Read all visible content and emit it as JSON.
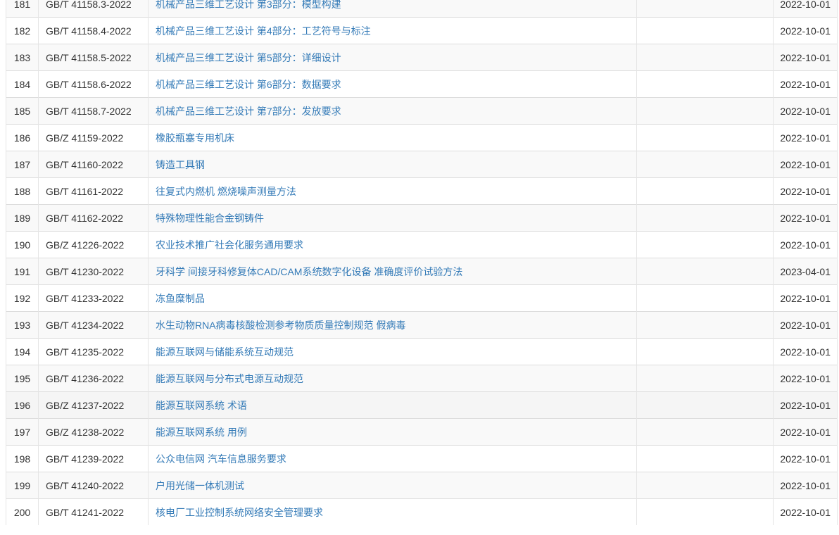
{
  "table": {
    "rows": [
      {
        "no": "181",
        "code": "GB/T 41158.3-2022",
        "title": "机械产品三维工艺设计 第3部分：模型构建",
        "date": "2022-10-01"
      },
      {
        "no": "182",
        "code": "GB/T 41158.4-2022",
        "title": "机械产品三维工艺设计 第4部分：工艺符号与标注",
        "date": "2022-10-01"
      },
      {
        "no": "183",
        "code": "GB/T 41158.5-2022",
        "title": "机械产品三维工艺设计 第5部分：详细设计",
        "date": "2022-10-01"
      },
      {
        "no": "184",
        "code": "GB/T 41158.6-2022",
        "title": "机械产品三维工艺设计 第6部分：数据要求",
        "date": "2022-10-01"
      },
      {
        "no": "185",
        "code": "GB/T 41158.7-2022",
        "title": "机械产品三维工艺设计 第7部分：发放要求",
        "date": "2022-10-01"
      },
      {
        "no": "186",
        "code": "GB/Z 41159-2022",
        "title": "橡胶瓶塞专用机床",
        "date": "2022-10-01"
      },
      {
        "no": "187",
        "code": "GB/T 41160-2022",
        "title": "铸造工具钢",
        "date": "2022-10-01"
      },
      {
        "no": "188",
        "code": "GB/T 41161-2022",
        "title": "往复式内燃机 燃烧噪声测量方法",
        "date": "2022-10-01"
      },
      {
        "no": "189",
        "code": "GB/T 41162-2022",
        "title": "特殊物理性能合金钢铸件",
        "date": "2022-10-01"
      },
      {
        "no": "190",
        "code": "GB/Z 41226-2022",
        "title": "农业技术推广社会化服务通用要求",
        "date": "2022-10-01"
      },
      {
        "no": "191",
        "code": "GB/T 41230-2022",
        "title": "牙科学 间接牙科修复体CAD/CAM系统数字化设备 准确度评价试验方法",
        "date": "2023-04-01"
      },
      {
        "no": "192",
        "code": "GB/T 41233-2022",
        "title": "冻鱼糜制品",
        "date": "2022-10-01"
      },
      {
        "no": "193",
        "code": "GB/T 41234-2022",
        "title": "水生动物RNA病毒核酸检测参考物质质量控制规范 假病毒",
        "date": "2022-10-01"
      },
      {
        "no": "194",
        "code": "GB/T 41235-2022",
        "title": "能源互联网与储能系统互动规范",
        "date": "2022-10-01"
      },
      {
        "no": "195",
        "code": "GB/T 41236-2022",
        "title": "能源互联网与分布式电源互动规范",
        "date": "2022-10-01"
      },
      {
        "no": "196",
        "code": "GB/Z 41237-2022",
        "title": "能源互联网系统 术语",
        "date": "2022-10-01"
      },
      {
        "no": "197",
        "code": "GB/Z 41238-2022",
        "title": "能源互联网系统 用例",
        "date": "2022-10-01"
      },
      {
        "no": "198",
        "code": "GB/T 41239-2022",
        "title": "公众电信网 汽车信息服务要求",
        "date": "2022-10-01"
      },
      {
        "no": "199",
        "code": "GB/T 41240-2022",
        "title": "户用光储一体机测试",
        "date": "2022-10-01"
      },
      {
        "no": "200",
        "code": "GB/T 41241-2022",
        "title": "核电厂工业控制系统网络安全管理要求",
        "date": "2022-10-01"
      }
    ],
    "hover_row_index": 15
  },
  "colors": {
    "link": "#337ab7",
    "text": "#333333",
    "stripe": "#f9f9f9",
    "hover": "#f5f5f5",
    "border": "#dddddd"
  }
}
